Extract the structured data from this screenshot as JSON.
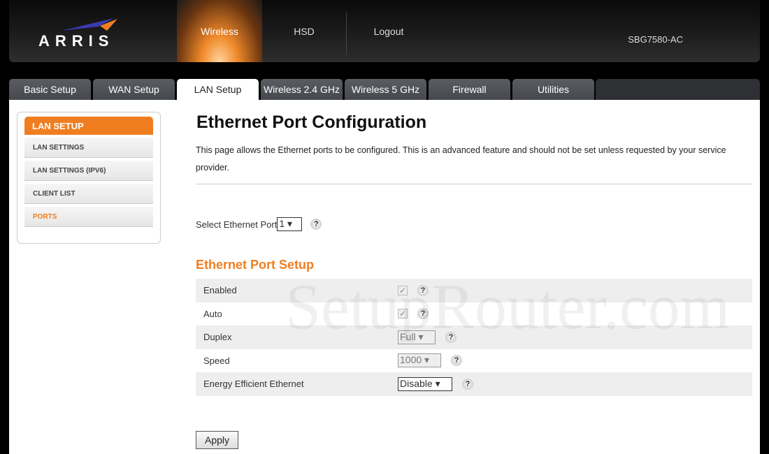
{
  "header": {
    "logo": "ARRIS",
    "nav": [
      "Wireless",
      "HSD",
      "Logout"
    ],
    "active_nav": "Wireless",
    "model": "SBG7580-AC"
  },
  "tabs": [
    "Basic Setup",
    "WAN Setup",
    "LAN Setup",
    "Wireless 2.4 GHz",
    "Wireless 5 GHz",
    "Firewall",
    "Utilities"
  ],
  "active_tab": "LAN Setup",
  "sidebar": {
    "title": "LAN SETUP",
    "items": [
      "LAN SETTINGS",
      "LAN SETTINGS (IPV6)",
      "CLIENT LIST",
      "PORTS"
    ],
    "active": "PORTS"
  },
  "page": {
    "title": "Ethernet Port Configuration",
    "description": "This page allows the Ethernet ports to be configured. This is an advanced feature and should not be set unless requested by your service provider.",
    "select_port_label": "Select Ethernet Port",
    "select_port_value": "1",
    "section_title": "Ethernet Port Setup",
    "fields": [
      {
        "label": "Enabled",
        "type": "checkbox",
        "checked": true,
        "disabled": true
      },
      {
        "label": "Auto",
        "type": "checkbox",
        "checked": true,
        "disabled": true
      },
      {
        "label": "Duplex",
        "type": "select",
        "value": "Full",
        "disabled": true
      },
      {
        "label": "Speed",
        "type": "select",
        "value": "1000",
        "disabled": true
      },
      {
        "label": "Energy Efficient Ethernet",
        "type": "select",
        "value": "Disable",
        "disabled": false
      }
    ],
    "help": "?",
    "apply_label": "Apply"
  },
  "watermark": "SetupRouter.com",
  "colors": {
    "accent": "#f07e20"
  }
}
